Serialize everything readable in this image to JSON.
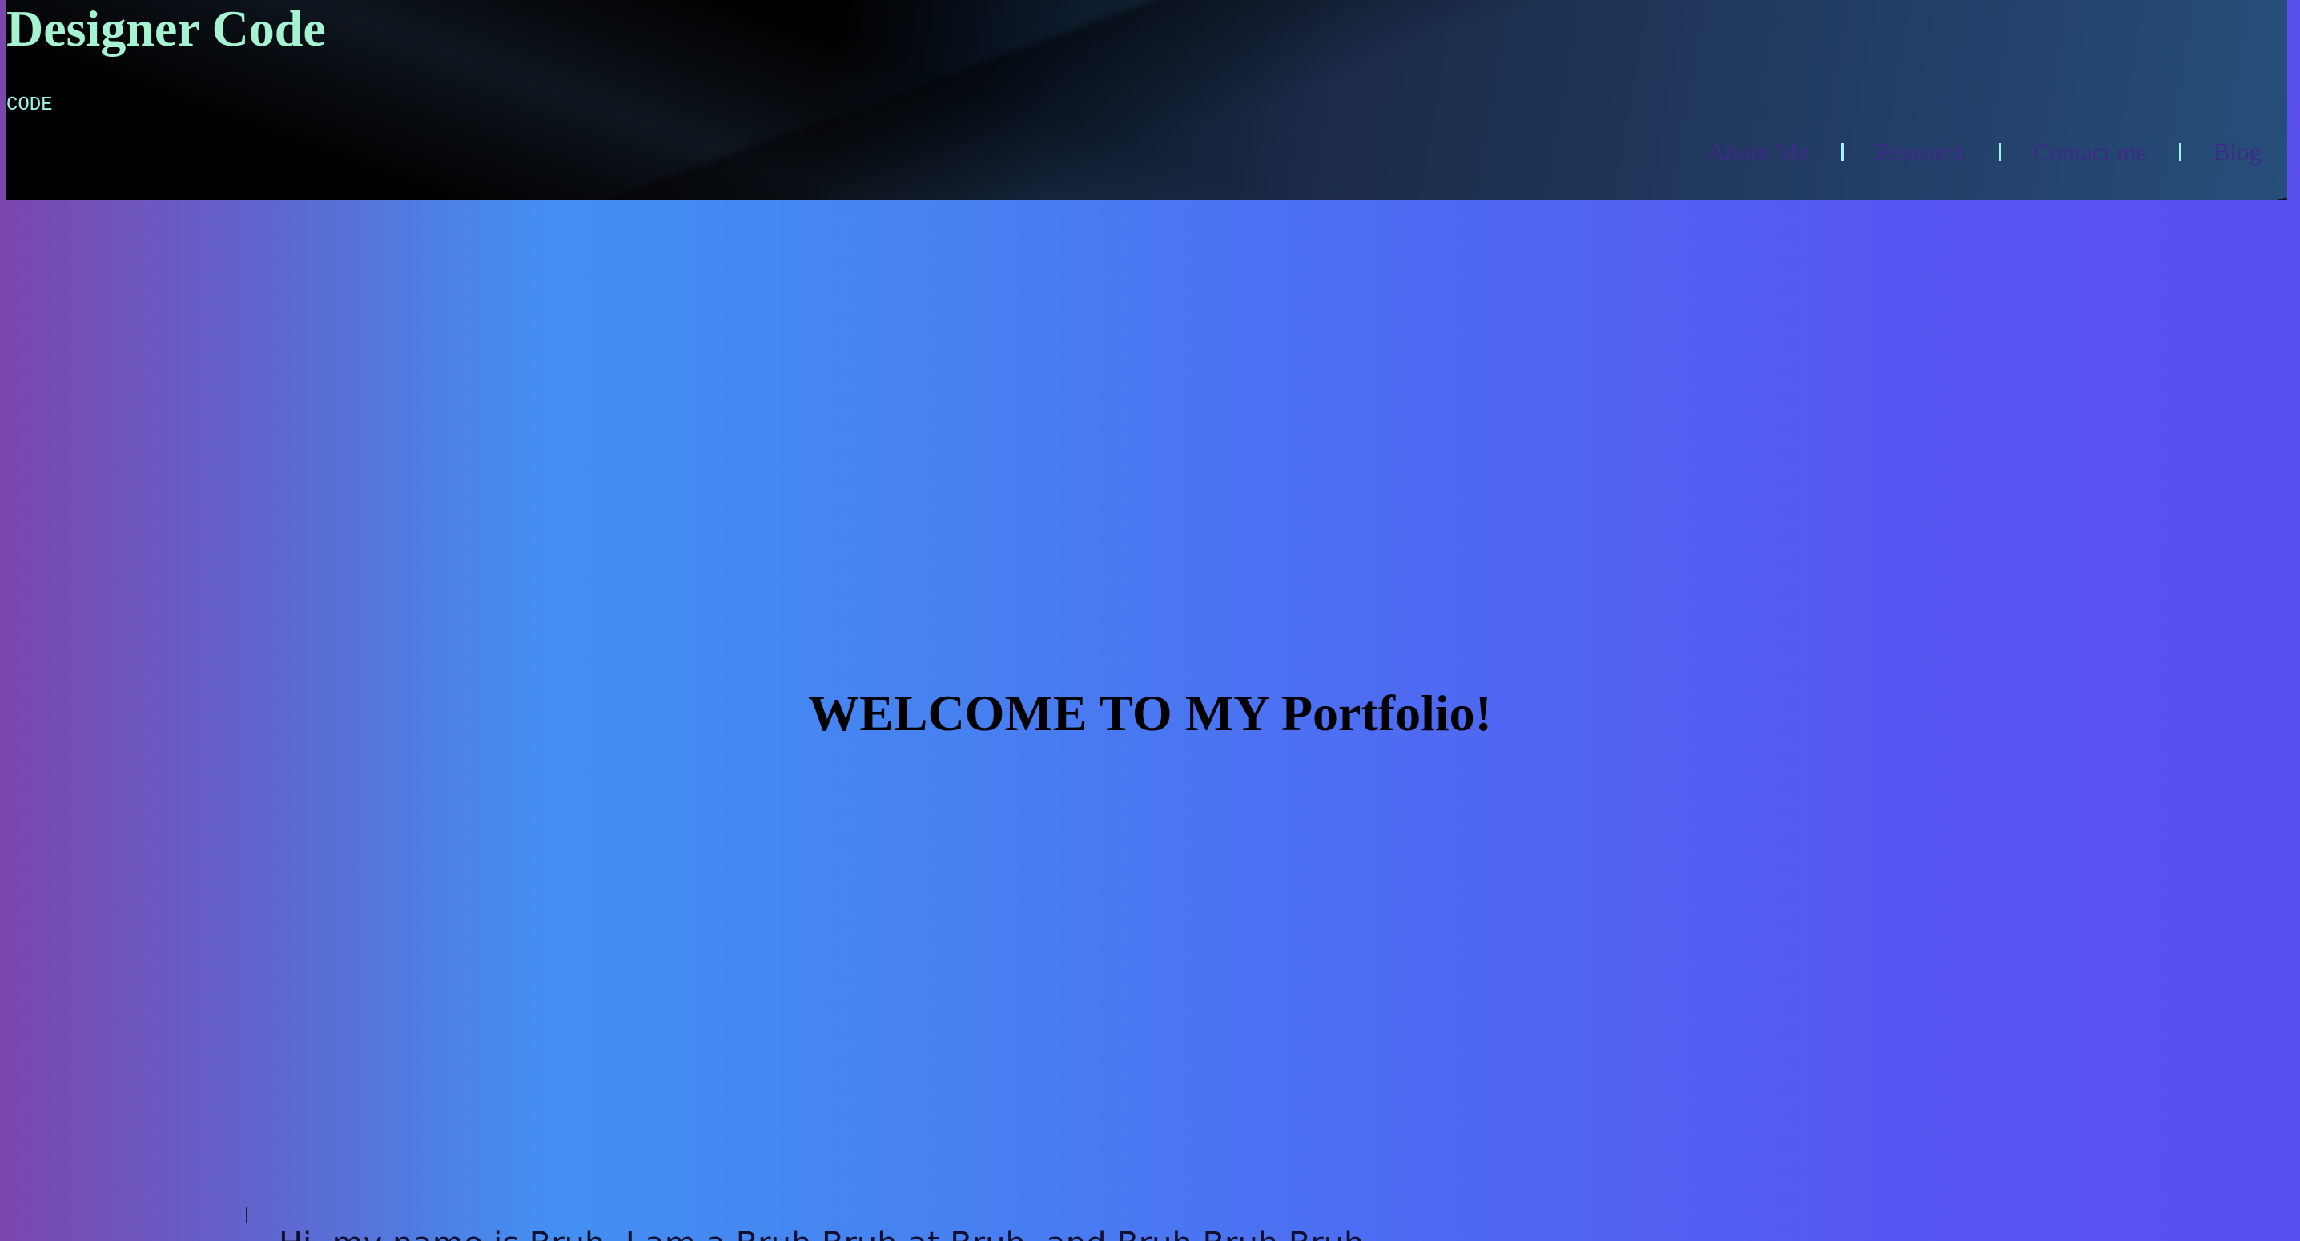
{
  "header": {
    "title": "Designer Code",
    "tagline": "CODE",
    "nav": [
      {
        "label": "About Me"
      },
      {
        "label": "Research"
      },
      {
        "label": "Contact me"
      },
      {
        "label": "Blog"
      }
    ]
  },
  "hero": {
    "heading": "WELCOME TO MY Portfolio!"
  },
  "intro": {
    "text": "Hi, my name is Bruh, I am a Bruh Bruh at Bruh, and Bruh Bruh Bruh"
  },
  "colors": {
    "title": "#a5f3d1",
    "nav_link": "#3d2a88",
    "nav_separator": "#9bf5ff",
    "gradient_left": "#7b47ad",
    "gradient_mid": "#4390f2",
    "gradient_right": "#594ff0"
  }
}
